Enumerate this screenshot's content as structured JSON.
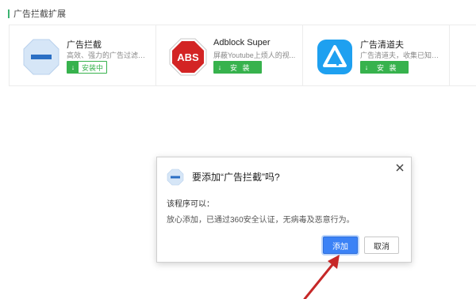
{
  "section": {
    "title": "广告拦截扩展"
  },
  "extensions": [
    {
      "name": "广告拦截",
      "desc": "高效、强力的广告过滤器...",
      "button": "安装中",
      "icon": "ad-block-hexagon-icon"
    },
    {
      "name": "Adblock Super",
      "desc": "屏蔽Youtube上烦人的视...",
      "button": "安 装",
      "icon": "abs-stop-sign-icon"
    },
    {
      "name": "广告清道夫",
      "desc": "广告清道夫，收集已知广...",
      "button": "安 装",
      "icon": "triangle-blue-icon"
    }
  ],
  "dialog": {
    "title": "要添加“广告拦截”吗?",
    "label": "该程序可以：",
    "body": "放心添加，已通过360安全认证，无病毒及恶意行为。",
    "add_label": "添加",
    "cancel_label": "取消",
    "close_icon": "close-icon"
  },
  "annotation": {
    "arrow_color": "#c62828"
  },
  "colors": {
    "accent_green": "#37b24d",
    "primary_blue": "#3b82f6"
  },
  "abs_logo_text": "ABS"
}
